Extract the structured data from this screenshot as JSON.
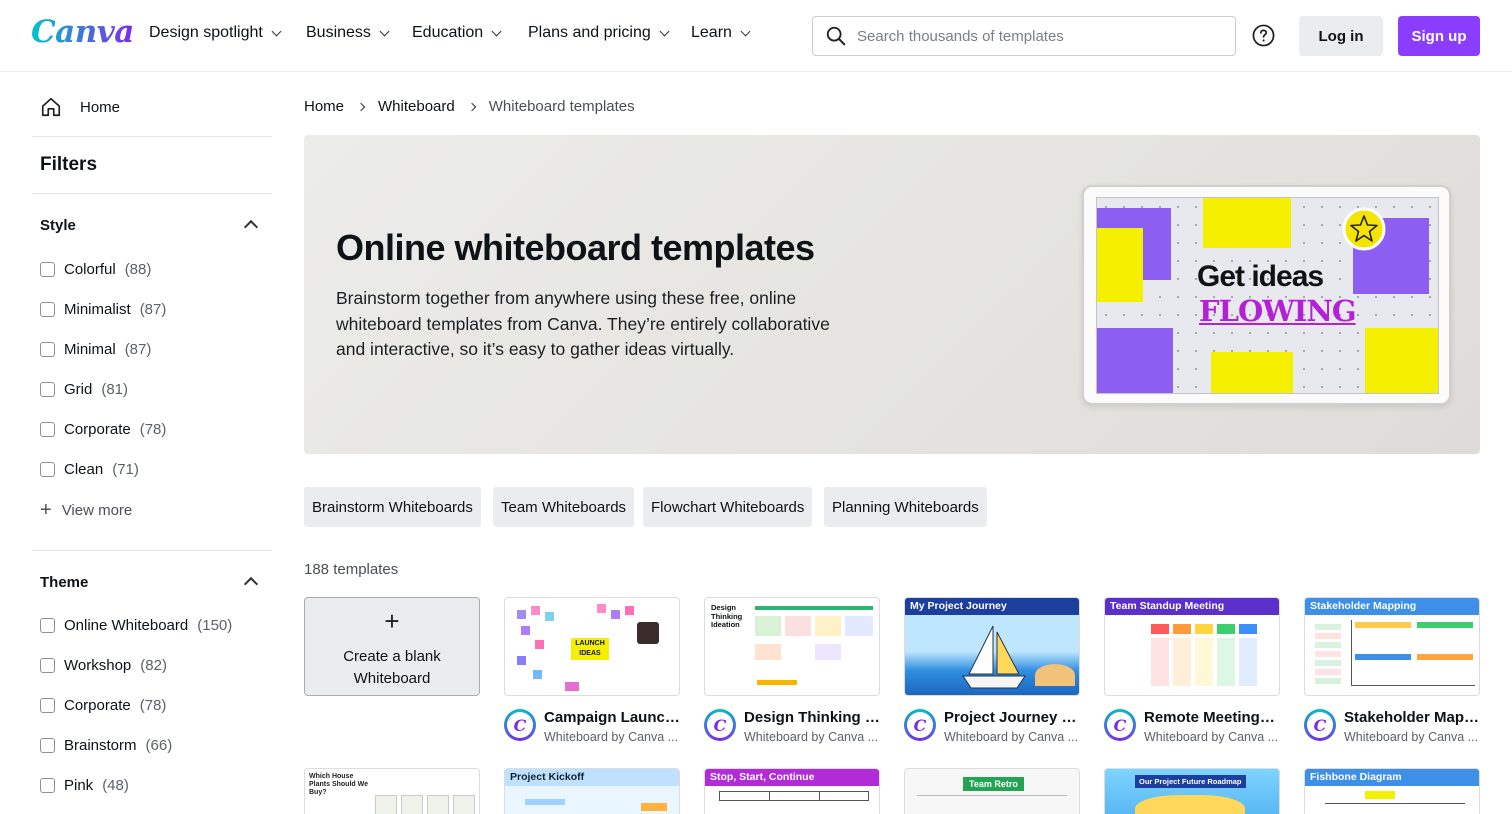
{
  "header": {
    "logo": "Canva",
    "nav": [
      "Design spotlight",
      "Business",
      "Education",
      "Plans and pricing",
      "Learn"
    ],
    "search_placeholder": "Search thousands of templates",
    "login": "Log in",
    "signup": "Sign up"
  },
  "sidebar": {
    "home": "Home",
    "filters_title": "Filters",
    "style": {
      "title": "Style",
      "items": [
        {
          "label": "Colorful",
          "count": "(88)"
        },
        {
          "label": "Minimalist",
          "count": "(87)"
        },
        {
          "label": "Minimal",
          "count": "(87)"
        },
        {
          "label": "Grid",
          "count": "(81)"
        },
        {
          "label": "Corporate",
          "count": "(78)"
        },
        {
          "label": "Clean",
          "count": "(71)"
        }
      ],
      "view_more": "View more"
    },
    "theme": {
      "title": "Theme",
      "items": [
        {
          "label": "Online Whiteboard",
          "count": "(150)"
        },
        {
          "label": "Workshop",
          "count": "(82)"
        },
        {
          "label": "Corporate",
          "count": "(78)"
        },
        {
          "label": "Brainstorm",
          "count": "(66)"
        },
        {
          "label": "Pink",
          "count": "(48)"
        }
      ]
    }
  },
  "breadcrumb": [
    "Home",
    "Whiteboard",
    "Whiteboard templates"
  ],
  "hero": {
    "title": "Online whiteboard templates",
    "description": "Brainstorm together from anywhere using these free, online whiteboard templates from Canva. They’re entirely collaborative and interactive, so it’s easy to gather ideas virtually.",
    "art_line1": "Get ideas",
    "art_line2": "FLOWING"
  },
  "chips": [
    "Brainstorm Whiteboards",
    "Team Whiteboards",
    "Flowchart Whiteboards",
    "Planning Whiteboards"
  ],
  "template_count": "188 templates",
  "blank_card": {
    "label_line1": "Create a blank",
    "label_line2": "Whiteboard"
  },
  "templates": [
    {
      "title": "Campaign Launch ...",
      "sub": "Whiteboard by Canva ...",
      "thumb_text": "LAUNCH IDEAS"
    },
    {
      "title": "Design Thinking Id...",
      "sub": "Whiteboard by Canva ...",
      "thumb_text": "Design Thinking Ideation"
    },
    {
      "title": "Project Journey W...",
      "sub": "Whiteboard by Canva ...",
      "thumb_text": "My Project Journey"
    },
    {
      "title": "Remote Meetings ...",
      "sub": "Whiteboard by Canva ...",
      "thumb_text": "Team Standup Meeting"
    },
    {
      "title": "Stakeholder Mapp...",
      "sub": "Whiteboard by Canva ...",
      "thumb_text": "Stakeholder Mapping"
    }
  ],
  "templates_row2": [
    {
      "thumb_text": "Which House Plants Should We Buy?"
    },
    {
      "thumb_text": "Project Kickoff"
    },
    {
      "thumb_text": "Stop, Start, Continue"
    },
    {
      "thumb_text": "Team Retro"
    },
    {
      "thumb_text": "Our Project Future Roadmap"
    },
    {
      "thumb_text": "Fishbone Diagram"
    }
  ],
  "colors": {
    "brand_purple": "#8b3dff",
    "brand_teal": "#00c4cc"
  },
  "icons": [
    "search-icon",
    "help-icon",
    "home-icon",
    "chevron-down-icon",
    "chevron-right-icon",
    "plus-icon"
  ]
}
